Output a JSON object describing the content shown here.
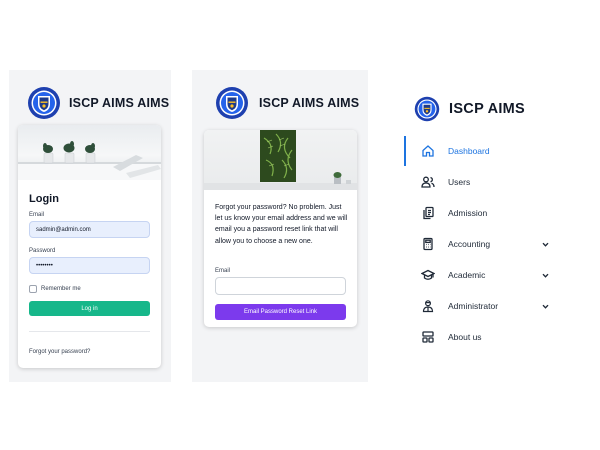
{
  "colors": {
    "accent_blue": "#1d74e0",
    "login_button": "#16b78a",
    "reset_button": "#7c3aed",
    "field_fill": "#e8effd",
    "logo_blue": "#1e40af"
  },
  "login_screen": {
    "brand": "ISCP AIMS AIMS",
    "title": "Login",
    "email_label": "Email",
    "email_value": "sadmin@admin.com",
    "password_label": "Password",
    "password_value": "••••••••",
    "remember_label": "Remember me",
    "login_button": "Log in",
    "forgot_link": "Forgot your password?"
  },
  "forgot_screen": {
    "brand": "ISCP AIMS AIMS",
    "message": "Forgot your password? No problem. Just let us know your email address and we will email you a password reset link that will allow you to choose a new one.",
    "email_label": "Email",
    "email_value": "",
    "submit_button": "Email Password Reset Link"
  },
  "sidebar": {
    "brand": "ISCP AIMS",
    "items": [
      {
        "label": "Dashboard",
        "icon": "home-icon",
        "active": true
      },
      {
        "label": "Users",
        "icon": "users-icon"
      },
      {
        "label": "Admission",
        "icon": "documents-icon"
      },
      {
        "label": "Accounting",
        "icon": "calculator-icon",
        "expandable": true
      },
      {
        "label": "Academic",
        "icon": "graduation-cap-icon",
        "expandable": true
      },
      {
        "label": "Administrator",
        "icon": "admin-icon",
        "expandable": true
      },
      {
        "label": "About us",
        "icon": "info-grid-icon"
      }
    ]
  }
}
